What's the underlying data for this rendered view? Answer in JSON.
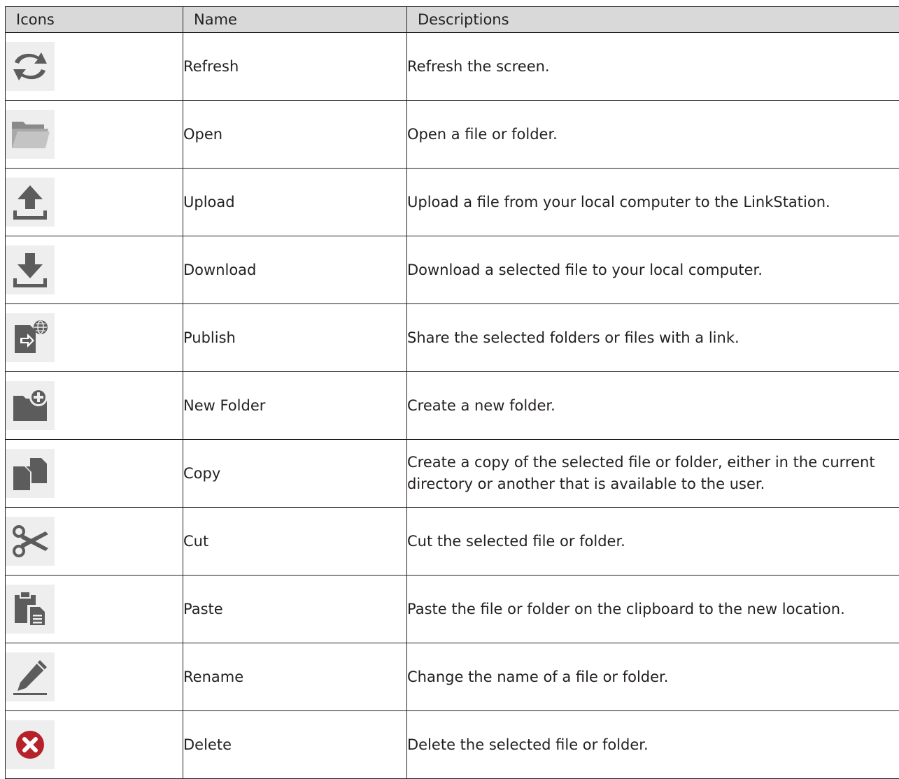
{
  "table": {
    "headers": {
      "icons": "Icons",
      "name": "Name",
      "descriptions": "Descriptions"
    },
    "rows": [
      {
        "icon": "refresh-icon",
        "name": "Refresh",
        "description": "Refresh the screen."
      },
      {
        "icon": "open-folder-icon",
        "name": "Open",
        "description": "Open a file or folder."
      },
      {
        "icon": "upload-icon",
        "name": "Upload",
        "description": "Upload a file from your local computer to the LinkStation."
      },
      {
        "icon": "download-icon",
        "name": "Download",
        "description": "Download a selected file to your local computer."
      },
      {
        "icon": "publish-icon",
        "name": "Publish",
        "description": "Share the selected folders or files with a link."
      },
      {
        "icon": "new-folder-icon",
        "name": "New Folder",
        "description": "Create a new folder."
      },
      {
        "icon": "copy-icon",
        "name": "Copy",
        "description": "Create a copy of the selected file or folder, either in the current directory or another that is available to the user."
      },
      {
        "icon": "cut-icon",
        "name": "Cut",
        "description": "Cut the selected file or folder."
      },
      {
        "icon": "paste-icon",
        "name": "Paste",
        "description": "Paste the file or folder on the clipboard to the new location."
      },
      {
        "icon": "rename-icon",
        "name": "Rename",
        "description": "Change the name of a file or folder."
      },
      {
        "icon": "delete-icon",
        "name": "Delete",
        "description": "Delete the selected file or folder."
      }
    ]
  },
  "colors": {
    "header_bg": "#d9d9d9",
    "border": "#231f20",
    "icon_tile_bg": "#eeeeee",
    "icon_gray": "#5c5c5c",
    "delete_red": "#b5222a"
  }
}
